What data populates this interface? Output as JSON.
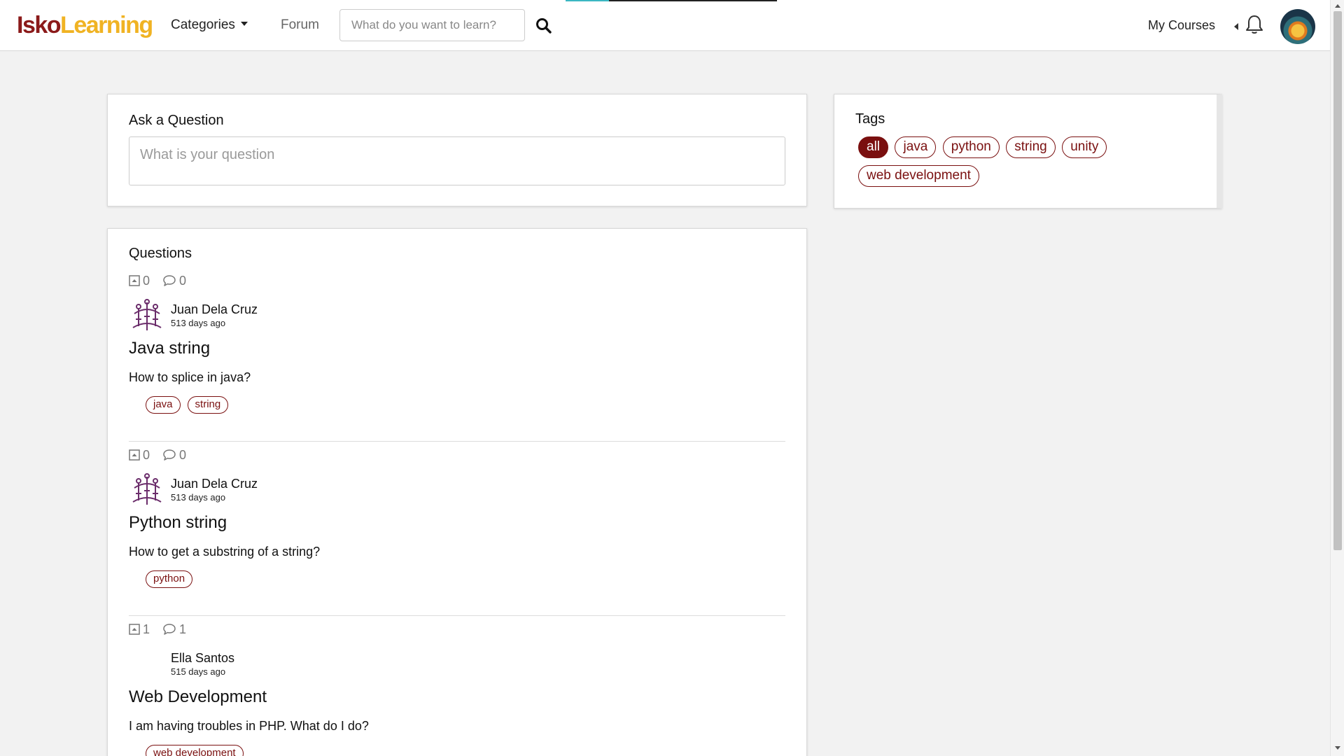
{
  "navbar": {
    "logo_part1": "Isko",
    "logo_part2": "Learning",
    "categories_label": "Categories",
    "forum_label": "Forum",
    "search_placeholder": "What do you want to learn?",
    "my_courses_label": "My Courses"
  },
  "ask": {
    "title": "Ask a Question",
    "placeholder": "What is your question"
  },
  "tags": {
    "title": "Tags",
    "items": [
      {
        "label": "all",
        "active": true
      },
      {
        "label": "java",
        "active": false
      },
      {
        "label": "python",
        "active": false
      },
      {
        "label": "string",
        "active": false
      },
      {
        "label": "unity",
        "active": false
      },
      {
        "label": "web development",
        "active": false
      }
    ]
  },
  "questions": {
    "title": "Questions",
    "items": [
      {
        "votes": "0",
        "comments": "0",
        "author": "Juan Dela Cruz",
        "time": "513 days ago",
        "title": "Java string",
        "body": "How to splice in java?",
        "tags": [
          "java",
          "string"
        ]
      },
      {
        "votes": "0",
        "comments": "0",
        "author": "Juan Dela Cruz",
        "time": "513 days ago",
        "title": "Python string",
        "body": "How to get a substring of a string?",
        "tags": [
          "python"
        ]
      },
      {
        "votes": "1",
        "comments": "1",
        "author": "Ella Santos",
        "time": "515 days ago",
        "title": "Web Development",
        "body": "I am having troubles in PHP. What do I do?",
        "tags": [
          "web development"
        ]
      }
    ]
  },
  "colors": {
    "brand_red": "#8b1a1a",
    "brand_gold": "#f0b323",
    "tag_maroon": "#7a1010"
  },
  "icons": [
    "search-icon",
    "bell-icon",
    "chevron-left-icon",
    "caret-down-icon",
    "upvote-icon",
    "comment-icon",
    "author-seal-icon"
  ]
}
